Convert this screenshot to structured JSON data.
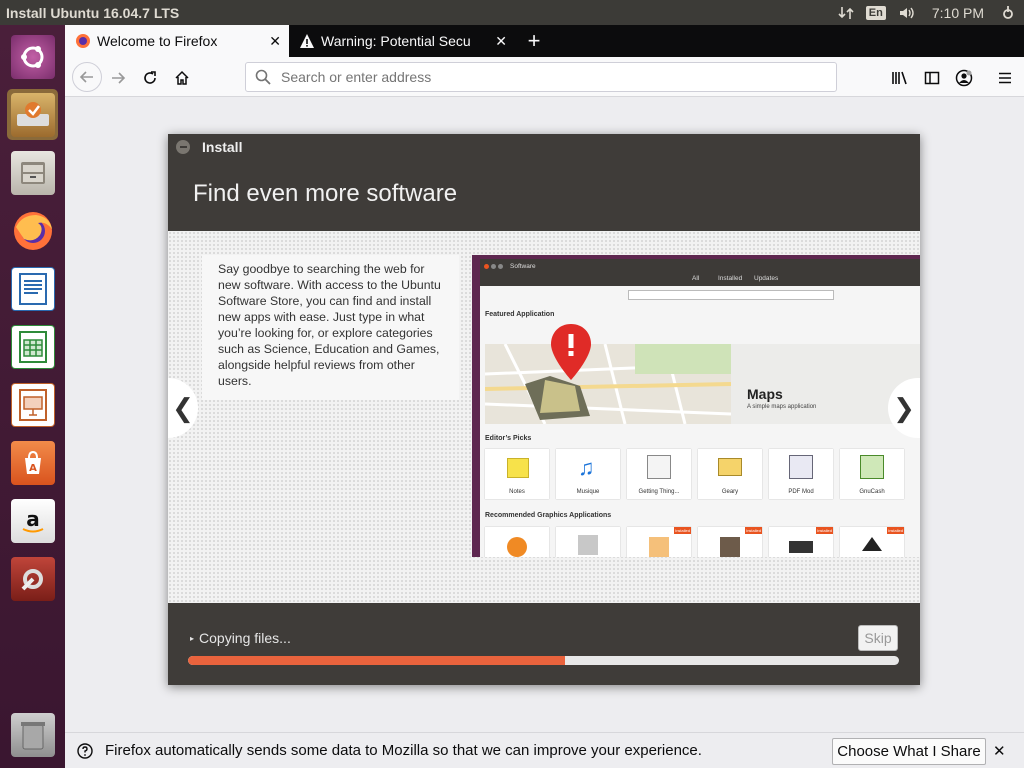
{
  "top_panel": {
    "title": "Install Ubuntu 16.04.7 LTS",
    "keyboard_layout": "En",
    "clock": "7:10 PM",
    "icons": [
      "network-icon",
      "keyboard-icon",
      "volume-icon",
      "settings-gear-icon"
    ]
  },
  "launcher": {
    "items": [
      {
        "name": "ubuntu-dash-icon"
      },
      {
        "name": "installer-icon"
      },
      {
        "name": "files-icon"
      },
      {
        "name": "firefox-icon"
      },
      {
        "name": "libreoffice-writer-icon"
      },
      {
        "name": "libreoffice-calc-icon"
      },
      {
        "name": "libreoffice-impress-icon"
      },
      {
        "name": "ubuntu-software-icon"
      },
      {
        "name": "amazon-icon"
      },
      {
        "name": "system-settings-icon"
      },
      {
        "name": "trash-icon"
      }
    ]
  },
  "browser": {
    "tabs": [
      {
        "label": "Welcome to Firefox",
        "active": true
      },
      {
        "label": "Warning: Potential Secu",
        "active": false
      }
    ],
    "new_tab": "+",
    "url_placeholder": "Search or enter address",
    "notification": {
      "message": "Firefox automatically sends some data to Mozilla so that we can improve your experience.",
      "button": "Choose What I Share",
      "close": "✕"
    }
  },
  "installer": {
    "window_title": "Install",
    "heading": "Find even more software",
    "slide_text": "Say goodbye to searching the web for new software. With access to the Ubuntu Software Store, you can find and install new apps with ease. Just type in what you’re looking for, or explore categories such as Science, Education and Games, alongside helpful reviews from other users.",
    "prev_arrow": "❮",
    "next_arrow": "❯",
    "status": "Copying files...",
    "skip_label": "Skip",
    "progress": 0.53,
    "accent": "#e9633d"
  },
  "software_screenshot": {
    "window_title": "Software",
    "tabs": [
      "All",
      "Installed",
      "Updates"
    ],
    "featured_label": "Featured Application",
    "featured_app": "Maps",
    "featured_desc": "A simple maps application",
    "editors_picks_label": "Editor’s Picks",
    "editors_picks": [
      "Notes",
      "Musique",
      "Getting Thing...",
      "Geary",
      "PDF Mod",
      "GnuCash"
    ],
    "recommended_label": "Recommended Graphics Applications",
    "installed_badge": "Installed"
  }
}
